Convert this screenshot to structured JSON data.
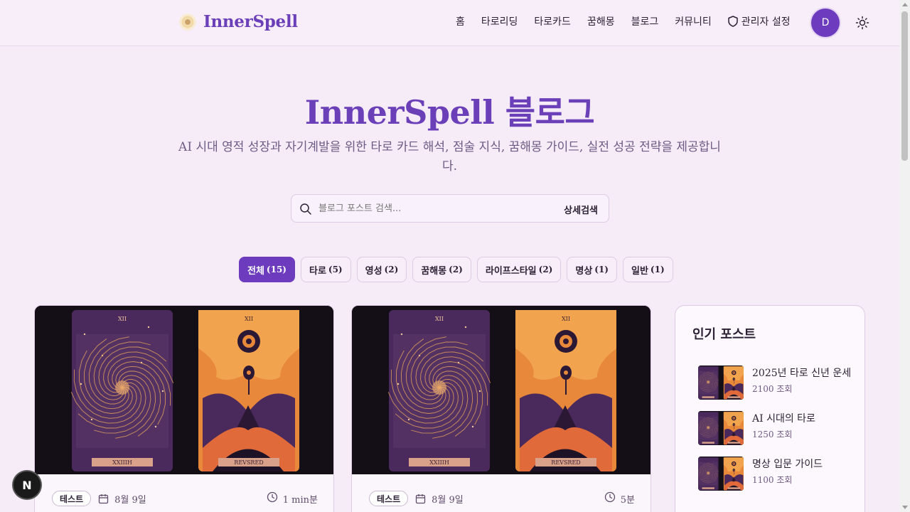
{
  "header": {
    "logo_text": "InnerSpell",
    "nav": [
      "홈",
      "타로리딩",
      "타로카드",
      "꿈해몽",
      "블로그",
      "커뮤니티"
    ],
    "admin_label": "관리자 설정",
    "avatar_initial": "D"
  },
  "hero": {
    "title": "InnerSpell 블로그",
    "description": "AI 시대 영적 성장과 자기계발을 위한 타로 카드 해석, 점술 지식, 꿈해몽 가이드, 실전 성공 전략을 제공합니다."
  },
  "search": {
    "placeholder": "블로그 포스트 검색...",
    "advanced_label": "상세검색"
  },
  "categories": [
    {
      "label": "전체",
      "count": "(15)",
      "active": true
    },
    {
      "label": "타로",
      "count": "(5)",
      "active": false
    },
    {
      "label": "영성",
      "count": "(2)",
      "active": false
    },
    {
      "label": "꿈해몽",
      "count": "(2)",
      "active": false
    },
    {
      "label": "라이프스타일",
      "count": "(2)",
      "active": false
    },
    {
      "label": "명상",
      "count": "(1)",
      "active": false
    },
    {
      "label": "일반",
      "count": "(1)",
      "active": false
    }
  ],
  "posts": [
    {
      "tag": "테스트",
      "date": "8월 9일",
      "read_time": "1 min분",
      "card_left_numeral": "XII",
      "card_right_numeral": "XII",
      "card_left_caption": "XXIIIH",
      "card_right_caption": "REVSRED"
    },
    {
      "tag": "테스트",
      "date": "8월 9일",
      "read_time": "5분",
      "card_left_numeral": "XII",
      "card_right_numeral": "XII",
      "card_left_caption": "XXIIIH",
      "card_right_caption": "REVSRED"
    }
  ],
  "sidebar": {
    "title": "인기 포스트",
    "items": [
      {
        "title": "2025년 타로 신년 운세",
        "views": "2100 조회"
      },
      {
        "title": "AI 시대의 타로",
        "views": "1250 조회"
      },
      {
        "title": "명상 입문 가이드",
        "views": "1100 조회"
      }
    ]
  },
  "fab_label": "N",
  "colors": {
    "accent": "#6d3bbd",
    "background": "#f6ecf8",
    "card_orange": "#e8883a",
    "card_purple": "#4a2a5c"
  }
}
